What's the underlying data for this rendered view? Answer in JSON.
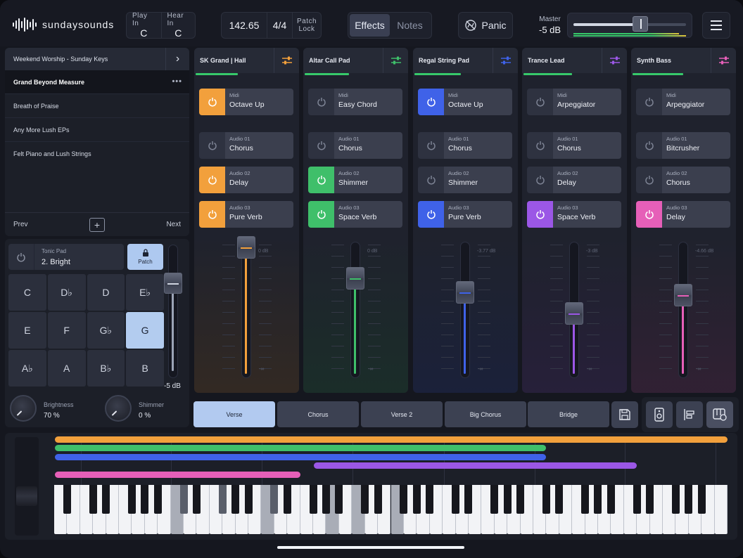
{
  "app": {
    "brand": "sundaysounds"
  },
  "header": {
    "play_in": {
      "label": "Play In",
      "value": "C"
    },
    "hear_in": {
      "label": "Hear In",
      "value": "C"
    },
    "tempo": "142.65",
    "time_sig": "4/4",
    "patch_lock": {
      "line1": "Patch",
      "line2": "Lock"
    },
    "tabs": [
      {
        "label": "Effects",
        "active": true
      },
      {
        "label": "Notes",
        "active": false
      }
    ],
    "panic": "Panic",
    "master": {
      "label": "Master",
      "value": "-5 dB"
    }
  },
  "setlist": {
    "title": "Weekend Worship - Sunday Keys",
    "songs": [
      {
        "name": "Grand Beyond Measure",
        "active": true
      },
      {
        "name": "Breath of Praise",
        "active": false
      },
      {
        "name": "Any More Lush EPs",
        "active": false
      },
      {
        "name": "Felt Piano and Lush Strings",
        "active": false
      }
    ],
    "prev": "Prev",
    "next": "Next"
  },
  "tonic_pad": {
    "label": "Tonic Pad",
    "value": "2. Bright",
    "patch": "Patch",
    "volume": "-5 dB",
    "keys": [
      "C",
      "D♭",
      "D",
      "E♭",
      "E",
      "F",
      "G♭",
      "G",
      "A♭",
      "A",
      "B♭",
      "B"
    ],
    "selected_key": "G",
    "brightness": {
      "label": "Brightness",
      "value": "70 %"
    },
    "shimmer": {
      "label": "Shimmer",
      "value": "0 %"
    }
  },
  "channels": [
    {
      "name": "SK Grand | Hall",
      "color": "#f2a03c",
      "midi": {
        "type": "Midi",
        "name": "Octave Up",
        "on": true
      },
      "audio": [
        {
          "type": "Audio 01",
          "name": "Chorus",
          "on": false
        },
        {
          "type": "Audio 02",
          "name": "Delay",
          "on": true
        },
        {
          "type": "Audio 03",
          "name": "Pure Verb",
          "on": true
        }
      ],
      "db": "0 dB",
      "level": 0.97
    },
    {
      "name": "Altar Call Pad",
      "color": "#3fbf6a",
      "midi": {
        "type": "Midi",
        "name": "Easy Chord",
        "on": false
      },
      "audio": [
        {
          "type": "Audio 01",
          "name": "Chorus",
          "on": false
        },
        {
          "type": "Audio 02",
          "name": "Shimmer",
          "on": true
        },
        {
          "type": "Audio 03",
          "name": "Space Verb",
          "on": true
        }
      ],
      "db": "0 dB",
      "level": 0.74
    },
    {
      "name": "Regal String Pad",
      "color": "#3f62e8",
      "midi": {
        "type": "Midi",
        "name": "Octave Up",
        "on": true
      },
      "audio": [
        {
          "type": "Audio 01",
          "name": "Chorus",
          "on": false
        },
        {
          "type": "Audio 02",
          "name": "Shimmer",
          "on": false
        },
        {
          "type": "Audio 03",
          "name": "Pure Verb",
          "on": true
        }
      ],
      "db": "-3.77 dB",
      "level": 0.64
    },
    {
      "name": "Trance Lead",
      "color": "#9b57e6",
      "midi": {
        "type": "Midi",
        "name": "Arpeggiator",
        "on": false
      },
      "audio": [
        {
          "type": "Audio 01",
          "name": "Chorus",
          "on": false
        },
        {
          "type": "Audio 02",
          "name": "Delay",
          "on": false
        },
        {
          "type": "Audio 03",
          "name": "Space Verb",
          "on": true
        }
      ],
      "db": "-3 dB",
      "level": 0.49
    },
    {
      "name": "Synth Bass",
      "color": "#e65fb8",
      "midi": {
        "type": "Midi",
        "name": "Arpeggiator",
        "on": false
      },
      "audio": [
        {
          "type": "Audio 01",
          "name": "Bitcrusher",
          "on": false
        },
        {
          "type": "Audio 02",
          "name": "Chorus",
          "on": false
        },
        {
          "type": "Audio 03",
          "name": "Delay",
          "on": true
        }
      ],
      "db": "-4.66 dB",
      "level": 0.62
    }
  ],
  "scenes": [
    {
      "label": "Verse",
      "active": true
    },
    {
      "label": "Chorus",
      "active": false
    },
    {
      "label": "Verse 2",
      "active": false
    },
    {
      "label": "Big Chorus",
      "active": false
    },
    {
      "label": "Bridge",
      "active": false
    }
  ],
  "keyboard_ranges": [
    {
      "color": "#f2a03c"
    },
    {
      "color": "#3fbf6a"
    },
    {
      "color": "#3f62e8"
    },
    {
      "color": "#9b57e6"
    },
    {
      "color": "#e65fb8"
    }
  ]
}
